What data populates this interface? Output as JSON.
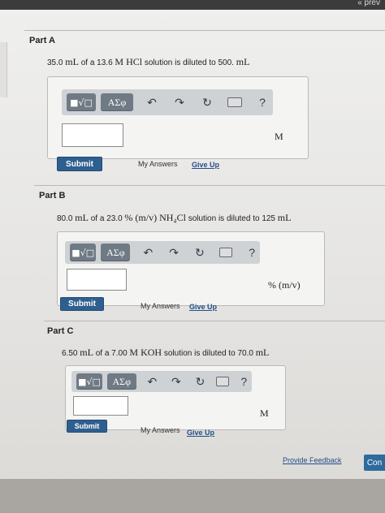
{
  "header": {
    "prev_label": "« prev"
  },
  "part_a": {
    "title": "Part A",
    "q_1": "35.0",
    "q_2": "mL",
    "q_3": "of a 13.6",
    "q_4": "M HCl",
    "q_5": "solution is diluted to 500.",
    "q_6": "mL",
    "toolbar": {
      "template": "■√□",
      "greek": "ΑΣφ",
      "help": "?"
    },
    "answer_value": "",
    "unit": "M",
    "submit": "Submit",
    "my_answers": "My Answers",
    "give_up": "Give Up"
  },
  "part_b": {
    "title": "Part B",
    "q_1": "80.0",
    "q_2": "mL",
    "q_3": "of a 23.0",
    "q_4": "% (m/v) NH₄Cl",
    "q_5": "solution is diluted to 125",
    "q_6": "mL",
    "toolbar": {
      "template": "■√□",
      "greek": "ΑΣφ",
      "help": "?"
    },
    "answer_value": "",
    "unit": "% (m/v)",
    "submit": "Submit",
    "my_answers": "My Answers",
    "give_up": "Give Up"
  },
  "part_c": {
    "title": "Part C",
    "q_1": "6.50",
    "q_2": "mL",
    "q_3": "of a 7.00",
    "q_4": "M KOH",
    "q_5": "solution is diluted to 70.0",
    "q_6": "mL",
    "toolbar": {
      "template": "■√□",
      "greek": "ΑΣφ",
      "help": "?"
    },
    "answer_value": "",
    "unit": "M",
    "submit": "Submit",
    "my_answers": "My Answers",
    "give_up": "Give Up"
  },
  "footer": {
    "provide_feedback": "Provide Feedback",
    "continue": "Con"
  }
}
